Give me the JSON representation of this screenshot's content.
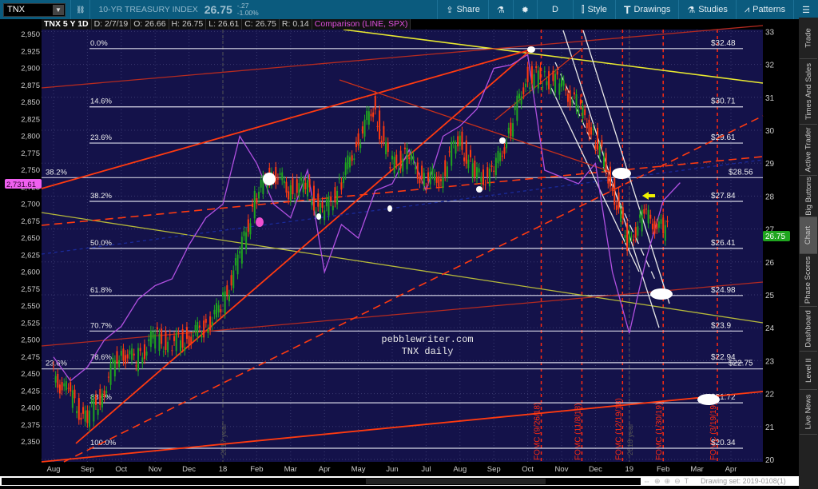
{
  "toolbar": {
    "symbol": "TNX",
    "index_name": "10-YR TREASURY INDEX",
    "last": "26.75",
    "change": "-.27",
    "change_pct": "-1.00%",
    "share": "Share",
    "period": "D",
    "style": "Style",
    "drawings": "Drawings",
    "studies": "Studies",
    "patterns": "Patterns"
  },
  "infobar": {
    "symbol": "TNX 5 Y 1D",
    "date": "D: 2/7/19",
    "open": "O: 26.66",
    "high": "H: 26.75",
    "low": "L: 26.61",
    "close": "C: 26.75",
    "range": "R: 0.14",
    "comparison": "Comparison (LINE, SPX)"
  },
  "sidebar": {
    "tabs": [
      "Trade",
      "Times And Sales",
      "Active Trader",
      "Big Buttons",
      "Chart",
      "Phase Scores",
      "Dashboard",
      "Level II",
      "Live News"
    ],
    "active": "Chart"
  },
  "footer": {
    "drawing_set": "Drawing set: 2019-0108(1)"
  },
  "colors": {
    "up": "#1fa51f",
    "down": "#ff3a10",
    "spx": "#b050e0",
    "background": "#14124a",
    "fomc": "#ff2a10"
  },
  "chart_data": {
    "type": "candlestick",
    "title": "TNX 5 Y 1D",
    "watermark": [
      "pebblewriter.com",
      "TNX daily"
    ],
    "right_axis": {
      "ticks": [
        20,
        21,
        22,
        23,
        24,
        25,
        26,
        27,
        28,
        29,
        30,
        31,
        32,
        33
      ],
      "range": [
        20,
        33.3
      ],
      "current_badge": "26.75"
    },
    "left_axis": {
      "ticks": [
        "2,350",
        "2,375",
        "2,400",
        "2,425",
        "2,450",
        "2,475",
        "2,500",
        "2,525",
        "2,550",
        "2,575",
        "2,600",
        "2,625",
        "2,650",
        "2,675",
        "2,700",
        "2,725",
        "2,750",
        "2,775",
        "2,800",
        "2,825",
        "2,850",
        "2,875",
        "2,900",
        "2,925",
        "2,950"
      ],
      "range": [
        2340,
        2958
      ],
      "current_badge": "2,731.61"
    },
    "x_labels": [
      "Aug",
      "Sep",
      "Oct",
      "Nov",
      "Dec",
      "18",
      "Feb",
      "Mar",
      "Apr",
      "May",
      "Jun",
      "Jul",
      "Aug",
      "Sep",
      "Oct",
      "Nov",
      "Dec",
      "19",
      "Feb",
      "Mar",
      "Apr"
    ],
    "x_index": "half-months from Aug 2017",
    "tnx_close": [
      22.6,
      22.0,
      21.2,
      22.0,
      23.3,
      23.0,
      23.7,
      23.5,
      23.7,
      24.0,
      24.6,
      26.0,
      27.9,
      28.8,
      28.2,
      28.3,
      27.4,
      28.3,
      29.6,
      30.7,
      28.9,
      29.2,
      28.5,
      28.6,
      29.8,
      28.6,
      28.6,
      29.9,
      31.6,
      31.6,
      31.4,
      30.8,
      29.9,
      28.5,
      26.6,
      27.4,
      27.0,
      26.75
    ],
    "spx_close": [
      2475,
      2440,
      2460,
      2500,
      2520,
      2560,
      2580,
      2590,
      2640,
      2680,
      2700,
      2800,
      2760,
      2700,
      2680,
      2750,
      2600,
      2670,
      2650,
      2720,
      2730,
      2780,
      2720,
      2800,
      2815,
      2840,
      2900,
      2905,
      2920,
      2750,
      2740,
      2730,
      2760,
      2600,
      2510,
      2620,
      2705,
      2731.61
    ],
    "fib_main": [
      {
        "pct": "0.0%",
        "price": 32.48,
        "label": "$32.48"
      },
      {
        "pct": "14.6%",
        "price": 30.71,
        "label": "$30.71"
      },
      {
        "pct": "23.6%",
        "price": 29.61,
        "label": "$29.61"
      },
      {
        "pct": "38.2%",
        "price": 27.84,
        "label": "$27.84"
      },
      {
        "pct": "50.0%",
        "price": 26.41,
        "label": "$26.41"
      },
      {
        "pct": "61.8%",
        "price": 24.98,
        "label": "$24.98"
      },
      {
        "pct": "70.7%",
        "price": 23.9,
        "label": "$23.9"
      },
      {
        "pct": "78.6%",
        "price": 22.94,
        "label": "$22.94"
      },
      {
        "pct": "88.6%",
        "price": 21.72,
        "label": "$21.72"
      },
      {
        "pct": "100.0%",
        "price": 20.34,
        "label": "$20.34"
      }
    ],
    "fib_secondary": [
      {
        "pct": "38.2%",
        "price": 28.56,
        "label": "$28.56"
      },
      {
        "pct": "23.6%",
        "price": 22.75,
        "label": "$22.75"
      }
    ],
    "fomc": [
      {
        "label": "FOMC (9/26/18)",
        "x": 28.8
      },
      {
        "label": "FOMC (11/8/18)",
        "x": 31.2
      },
      {
        "label": "FOMC (12/19/18)",
        "x": 33.6
      },
      {
        "label": "FOMC (1/30/19)",
        "x": 36.0
      },
      {
        "label": "FOMC (3/19/19)",
        "x": 39.2
      }
    ],
    "year_markers": [
      {
        "label": "2017 year",
        "x": 10.0
      },
      {
        "label": "2018 year",
        "x": 34.0
      }
    ]
  }
}
